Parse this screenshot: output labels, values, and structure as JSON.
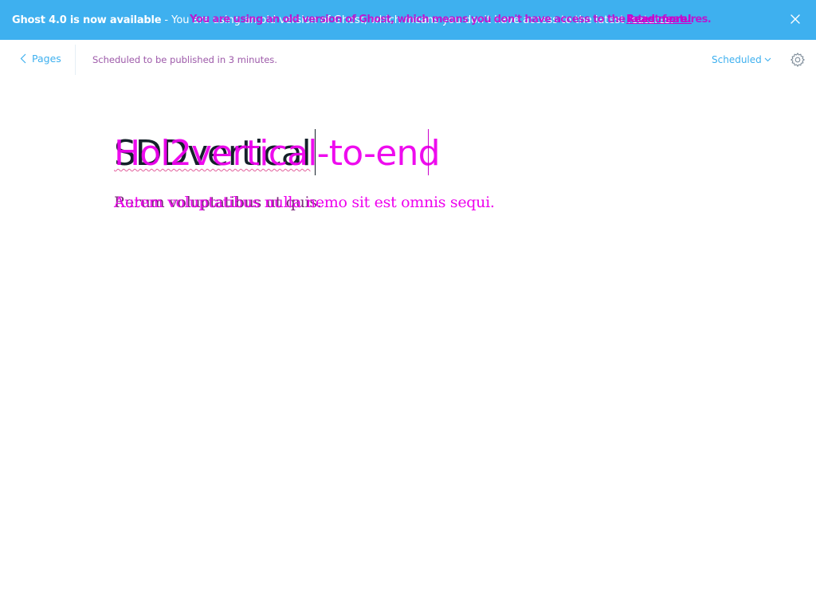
{
  "banner": {
    "title": "Ghost 4.0 is now available",
    "separator": "-",
    "message": "You are using an old version of Ghost, which means you don't have access to the latest features.",
    "message_overlay": "You are using an old version of Ghost, which means you don't have access to the latest features.",
    "link_label": "Read more!",
    "close_icon": "close-icon"
  },
  "header": {
    "back_label": "Pages",
    "status_text": "Scheduled to be published in 3 minutes.",
    "status_overlay": "Scheduled to be published in 3 minutes.",
    "publish_menu_label": "Scheduled",
    "settings_icon": "gear-icon"
  },
  "editor": {
    "title": "SDDvertical",
    "title_overlay": "Hol2vertical-to-end",
    "excerpt": "Rerum voluptatibus ut quis.",
    "excerpt_overlay": "Autem voluptatibus nulla nemo sit est omnis sequi."
  },
  "colors": {
    "banner_bg": "#3eb0ef",
    "accent": "#3eb0ef",
    "overlay": "#ee00ee"
  }
}
